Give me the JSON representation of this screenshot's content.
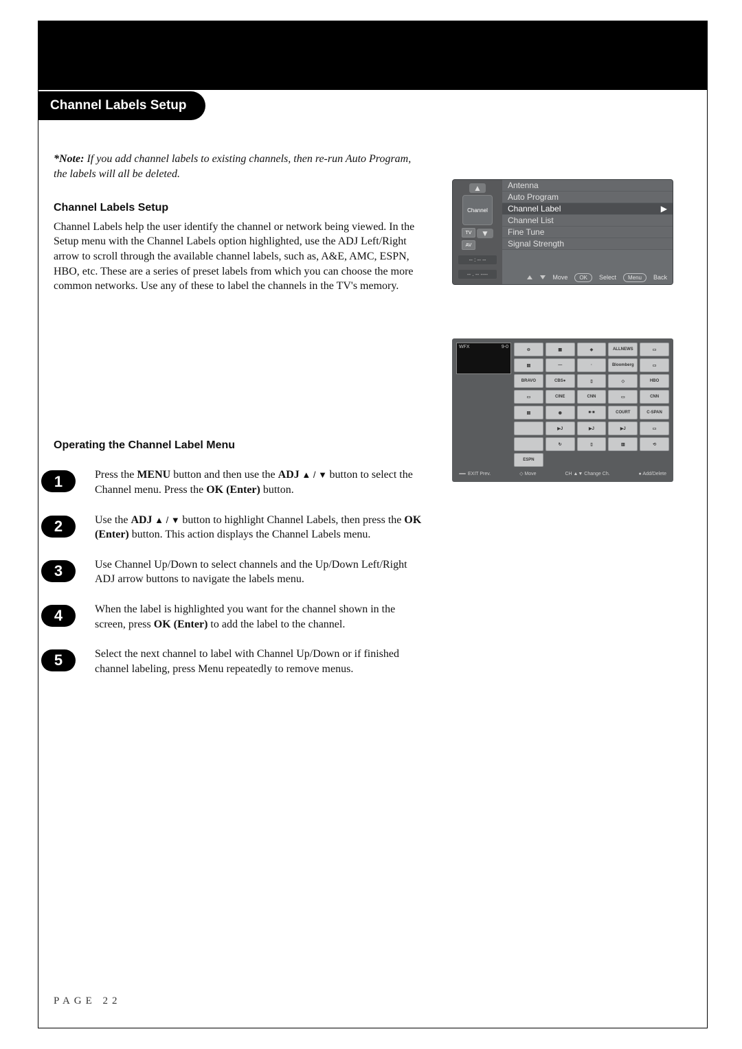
{
  "page": {
    "title": "Channel Labels Setup",
    "footer": "PAGE 22"
  },
  "note": {
    "label": "*Note:",
    "text": "If you add channel labels to existing channels, then re-run Auto Program, the labels will all be deleted."
  },
  "section": {
    "heading": "Channel Labels Setup",
    "body": "Channel Labels help the user identify the channel or network being viewed. In the Setup menu with the Channel Labels option highlighted, use the ADJ Left/Right arrow to scroll through the available channel labels, such as, A&E, AMC, ESPN, HBO, etc. These are a series of preset labels from which you can choose the more common networks. Use any of these to label the channels in the TV's memory."
  },
  "operating": {
    "heading": "Operating the Channel Label Menu",
    "steps": [
      {
        "num": "1",
        "pre": "Press the ",
        "b1": "MENU",
        "mid1": " button and then use the ",
        "b2": "ADJ",
        "arrows": " ▲ / ▼ ",
        "mid2": "button to select the Channel menu. Press the ",
        "b3": "OK (Enter)",
        "post": " button."
      },
      {
        "num": "2",
        "pre": "Use the ",
        "b1": "ADJ",
        "arrows": " ▲ / ▼ ",
        "mid1": "button to highlight Channel Labels, then press the ",
        "b2": "OK (Enter)",
        "post": " button. This action displays the Channel Labels menu."
      },
      {
        "num": "3",
        "text": "Use Channel Up/Down to select channels and the Up/Down Left/Right ADJ arrow buttons to navigate the labels menu."
      },
      {
        "num": "4",
        "pre": "When the label is highlighted you want for the channel shown in the screen, press ",
        "b1": "OK (Enter)",
        "post": " to add the label to the channel."
      },
      {
        "num": "5",
        "text": "Select the next channel to label with Channel Up/Down or if finished channel labeling, press Menu repeatedly to remove menus."
      }
    ]
  },
  "osd": {
    "icon_label": "Channel",
    "side_btns": [
      "TV",
      "AV"
    ],
    "status1": "-- : -- --",
    "status2": "-- . -- ----",
    "rows": [
      "Antenna",
      "Auto Program",
      "Channel Label",
      "Channel List",
      "Fine Tune",
      "Signal Strength"
    ],
    "selected_index": 2,
    "footer": {
      "move": "Move",
      "ok": "OK",
      "select": "Select",
      "menu": "Menu",
      "back": "Back"
    }
  },
  "grid": {
    "preview_left": "WFX",
    "preview_right": "9-0",
    "logos": [
      "⊖",
      "▦",
      "◈",
      "ALLNEWS",
      "▭",
      "▤",
      "—",
      "·",
      "Bloomberg",
      "▭",
      "BRAVO",
      "CBS●",
      "▯",
      "◇",
      "HBO",
      "▭",
      "CINE",
      "CNN",
      "▭",
      "CNN",
      "▤",
      "◉",
      "■·■",
      "COURT",
      "C-SPAN",
      "",
      "▶J",
      "▶J",
      "▶J",
      "▭",
      "",
      "↻",
      "▯",
      "▥",
      "⟲",
      "ESPN"
    ],
    "footer": [
      "EXIT Prev.",
      "◇ Move",
      "CH ▲▼ Change Ch.",
      "● Add/Delete"
    ]
  }
}
